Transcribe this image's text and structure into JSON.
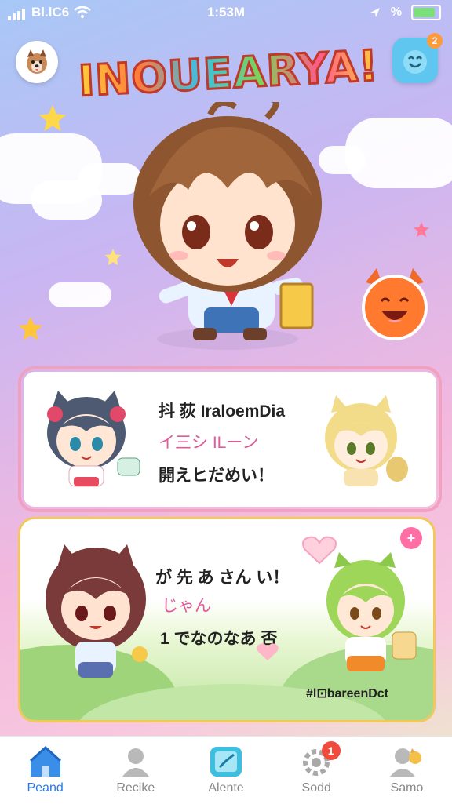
{
  "status_bar": {
    "carrier": "Bl.lC6",
    "time": "1:53M"
  },
  "header": {
    "logo_text": "INOUEARYA!",
    "notification_count": "2"
  },
  "card1": {
    "title": "抖 荻 IraloemDia",
    "subtitle": "イ三シ ILーン",
    "body": "開えヒだめい！"
  },
  "card2": {
    "title": "が 先 あ さん い！",
    "subtitle": "じゃん",
    "body": "1 でなのなあ 否",
    "caption": "#l⊡bareenDct",
    "plus_label": "+"
  },
  "nav": {
    "items": [
      {
        "label": "Peand",
        "icon": "home-icon"
      },
      {
        "label": "Recike",
        "icon": "profile-icon"
      },
      {
        "label": "Alente",
        "icon": "edit-icon"
      },
      {
        "label": "Sodd",
        "icon": "settings-icon",
        "badge": "1"
      },
      {
        "label": "Samo",
        "icon": "friend-icon"
      }
    ]
  },
  "colors": {
    "accent": "#2b78e4",
    "badge": "#f04b3c",
    "card1_border": "#f2a0c0",
    "card2_border": "#f2c85a"
  }
}
